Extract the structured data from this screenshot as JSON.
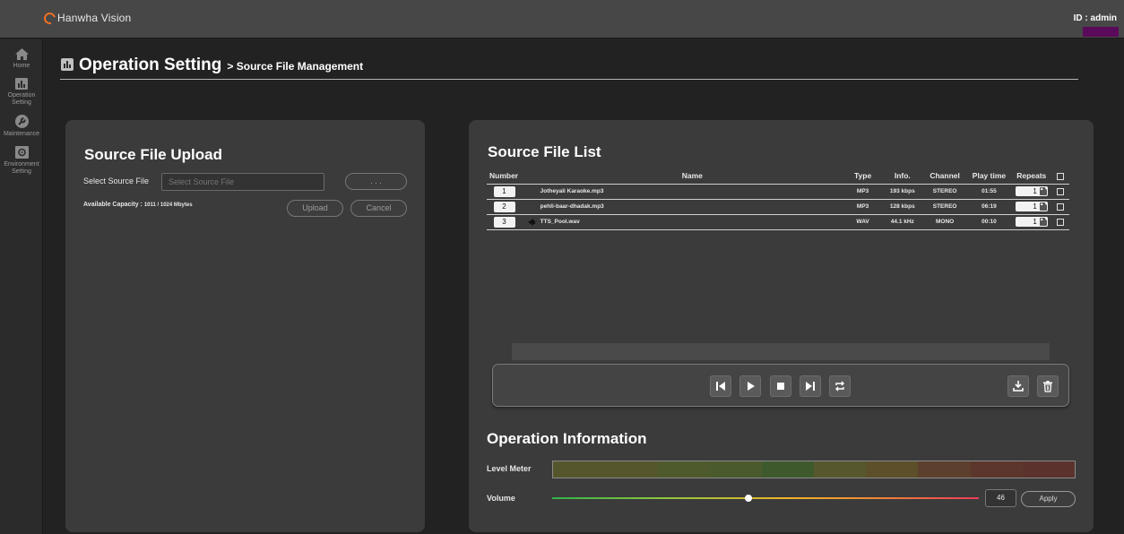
{
  "header": {
    "brand": "Hanwha Vision",
    "user_id": "ID : admin"
  },
  "sidebar": {
    "items": [
      {
        "icon": "home-icon",
        "label": "Home"
      },
      {
        "icon": "chart-icon",
        "label": "Operation Setting"
      },
      {
        "icon": "wrench-icon",
        "label": "Maintenance"
      },
      {
        "icon": "gear-icon",
        "label": "Environment Setting"
      }
    ]
  },
  "page": {
    "title": "Operation Setting",
    "breadcrumb": "> Source File Management"
  },
  "upload": {
    "title": "Source File Upload",
    "select_label": "Select Source File",
    "select_placeholder": "Select Source File",
    "browse_label": ". . .",
    "capacity_label": "Available Capacity :",
    "capacity_value": "1011 / 1024 Mbytes",
    "upload_label": "Upload",
    "cancel_label": "Cancel"
  },
  "file_list": {
    "title": "Source File List",
    "columns": [
      "Number",
      "Name",
      "Type",
      "Info.",
      "Channel",
      "Play time",
      "Repeats"
    ],
    "rows": [
      {
        "number": "1",
        "name": "Jotheyali Karaoke.mp3",
        "type": "MP3",
        "info": "193 kbps",
        "channel": "STEREO",
        "play_time": "01:55",
        "repeats": "1",
        "playing": false
      },
      {
        "number": "2",
        "name": "pehli-baar-dhadak.mp3",
        "type": "MP3",
        "info": "128 kbps",
        "channel": "STEREO",
        "play_time": "06:19",
        "repeats": "1",
        "playing": false
      },
      {
        "number": "3",
        "name": "TTS_Pool.wav",
        "type": "WAV",
        "info": "44.1 kHz",
        "channel": "MONO",
        "play_time": "00:10",
        "repeats": "1",
        "playing": true
      }
    ]
  },
  "operation": {
    "title": "Operation Information",
    "level_meter_label": "Level Meter",
    "level_meter_colors": [
      "#56562d",
      "#56562d",
      "#4f5a2c",
      "#4a5a2c",
      "#3e5a2c",
      "#56572c",
      "#5c4f2a",
      "#5c3f2c",
      "#5c362c",
      "#5c322c"
    ],
    "volume_label": "Volume",
    "volume_value": "46",
    "volume_percent": 46,
    "apply_label": "Apply"
  }
}
